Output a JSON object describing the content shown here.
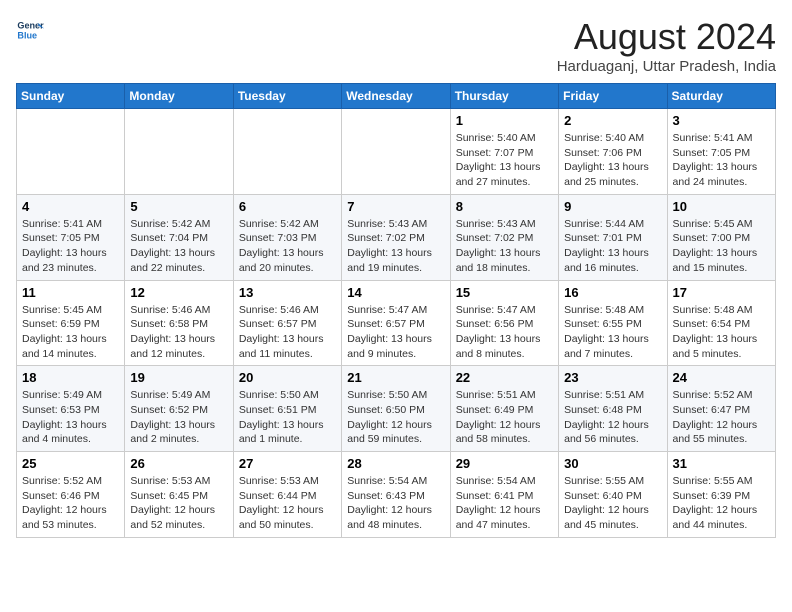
{
  "header": {
    "logo_line1": "General",
    "logo_line2": "Blue",
    "month_title": "August 2024",
    "location": "Harduaganj, Uttar Pradesh, India"
  },
  "weekdays": [
    "Sunday",
    "Monday",
    "Tuesday",
    "Wednesday",
    "Thursday",
    "Friday",
    "Saturday"
  ],
  "weeks": [
    [
      {
        "day": "",
        "info": ""
      },
      {
        "day": "",
        "info": ""
      },
      {
        "day": "",
        "info": ""
      },
      {
        "day": "",
        "info": ""
      },
      {
        "day": "1",
        "info": "Sunrise: 5:40 AM\nSunset: 7:07 PM\nDaylight: 13 hours\nand 27 minutes."
      },
      {
        "day": "2",
        "info": "Sunrise: 5:40 AM\nSunset: 7:06 PM\nDaylight: 13 hours\nand 25 minutes."
      },
      {
        "day": "3",
        "info": "Sunrise: 5:41 AM\nSunset: 7:05 PM\nDaylight: 13 hours\nand 24 minutes."
      }
    ],
    [
      {
        "day": "4",
        "info": "Sunrise: 5:41 AM\nSunset: 7:05 PM\nDaylight: 13 hours\nand 23 minutes."
      },
      {
        "day": "5",
        "info": "Sunrise: 5:42 AM\nSunset: 7:04 PM\nDaylight: 13 hours\nand 22 minutes."
      },
      {
        "day": "6",
        "info": "Sunrise: 5:42 AM\nSunset: 7:03 PM\nDaylight: 13 hours\nand 20 minutes."
      },
      {
        "day": "7",
        "info": "Sunrise: 5:43 AM\nSunset: 7:02 PM\nDaylight: 13 hours\nand 19 minutes."
      },
      {
        "day": "8",
        "info": "Sunrise: 5:43 AM\nSunset: 7:02 PM\nDaylight: 13 hours\nand 18 minutes."
      },
      {
        "day": "9",
        "info": "Sunrise: 5:44 AM\nSunset: 7:01 PM\nDaylight: 13 hours\nand 16 minutes."
      },
      {
        "day": "10",
        "info": "Sunrise: 5:45 AM\nSunset: 7:00 PM\nDaylight: 13 hours\nand 15 minutes."
      }
    ],
    [
      {
        "day": "11",
        "info": "Sunrise: 5:45 AM\nSunset: 6:59 PM\nDaylight: 13 hours\nand 14 minutes."
      },
      {
        "day": "12",
        "info": "Sunrise: 5:46 AM\nSunset: 6:58 PM\nDaylight: 13 hours\nand 12 minutes."
      },
      {
        "day": "13",
        "info": "Sunrise: 5:46 AM\nSunset: 6:57 PM\nDaylight: 13 hours\nand 11 minutes."
      },
      {
        "day": "14",
        "info": "Sunrise: 5:47 AM\nSunset: 6:57 PM\nDaylight: 13 hours\nand 9 minutes."
      },
      {
        "day": "15",
        "info": "Sunrise: 5:47 AM\nSunset: 6:56 PM\nDaylight: 13 hours\nand 8 minutes."
      },
      {
        "day": "16",
        "info": "Sunrise: 5:48 AM\nSunset: 6:55 PM\nDaylight: 13 hours\nand 7 minutes."
      },
      {
        "day": "17",
        "info": "Sunrise: 5:48 AM\nSunset: 6:54 PM\nDaylight: 13 hours\nand 5 minutes."
      }
    ],
    [
      {
        "day": "18",
        "info": "Sunrise: 5:49 AM\nSunset: 6:53 PM\nDaylight: 13 hours\nand 4 minutes."
      },
      {
        "day": "19",
        "info": "Sunrise: 5:49 AM\nSunset: 6:52 PM\nDaylight: 13 hours\nand 2 minutes."
      },
      {
        "day": "20",
        "info": "Sunrise: 5:50 AM\nSunset: 6:51 PM\nDaylight: 13 hours\nand 1 minute."
      },
      {
        "day": "21",
        "info": "Sunrise: 5:50 AM\nSunset: 6:50 PM\nDaylight: 12 hours\nand 59 minutes."
      },
      {
        "day": "22",
        "info": "Sunrise: 5:51 AM\nSunset: 6:49 PM\nDaylight: 12 hours\nand 58 minutes."
      },
      {
        "day": "23",
        "info": "Sunrise: 5:51 AM\nSunset: 6:48 PM\nDaylight: 12 hours\nand 56 minutes."
      },
      {
        "day": "24",
        "info": "Sunrise: 5:52 AM\nSunset: 6:47 PM\nDaylight: 12 hours\nand 55 minutes."
      }
    ],
    [
      {
        "day": "25",
        "info": "Sunrise: 5:52 AM\nSunset: 6:46 PM\nDaylight: 12 hours\nand 53 minutes."
      },
      {
        "day": "26",
        "info": "Sunrise: 5:53 AM\nSunset: 6:45 PM\nDaylight: 12 hours\nand 52 minutes."
      },
      {
        "day": "27",
        "info": "Sunrise: 5:53 AM\nSunset: 6:44 PM\nDaylight: 12 hours\nand 50 minutes."
      },
      {
        "day": "28",
        "info": "Sunrise: 5:54 AM\nSunset: 6:43 PM\nDaylight: 12 hours\nand 48 minutes."
      },
      {
        "day": "29",
        "info": "Sunrise: 5:54 AM\nSunset: 6:41 PM\nDaylight: 12 hours\nand 47 minutes."
      },
      {
        "day": "30",
        "info": "Sunrise: 5:55 AM\nSunset: 6:40 PM\nDaylight: 12 hours\nand 45 minutes."
      },
      {
        "day": "31",
        "info": "Sunrise: 5:55 AM\nSunset: 6:39 PM\nDaylight: 12 hours\nand 44 minutes."
      }
    ]
  ]
}
